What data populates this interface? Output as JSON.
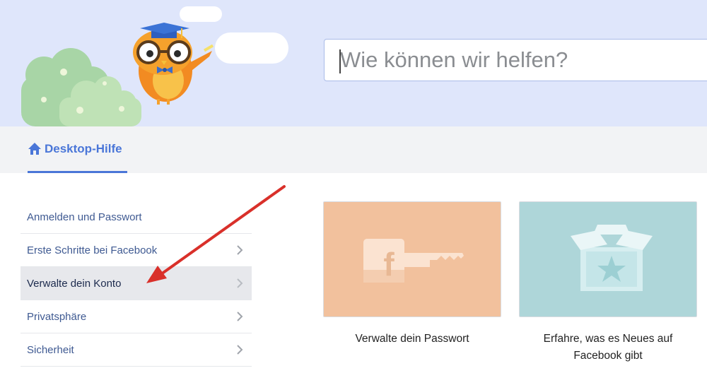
{
  "search": {
    "placeholder": "Wie können wir helfen?"
  },
  "nav": {
    "tab_label": "Desktop-Hilfe"
  },
  "sidebar": {
    "items": [
      {
        "label": "Anmelden und Passwort"
      },
      {
        "label": "Erste Schritte bei Facebook"
      },
      {
        "label": "Verwalte dein Konto"
      },
      {
        "label": "Privatsphäre"
      },
      {
        "label": "Sicherheit"
      }
    ]
  },
  "cards": [
    {
      "caption": "Verwalte dein Passwort"
    },
    {
      "caption": "Erfahre, was es Neues auf Facebook gibt"
    }
  ],
  "colors": {
    "hero_bg": "#dfe6fb",
    "accent": "#4a76d8",
    "annotation_arrow": "#d9302a",
    "card_password": "#f2c19d",
    "card_news": "#aed6d9"
  }
}
